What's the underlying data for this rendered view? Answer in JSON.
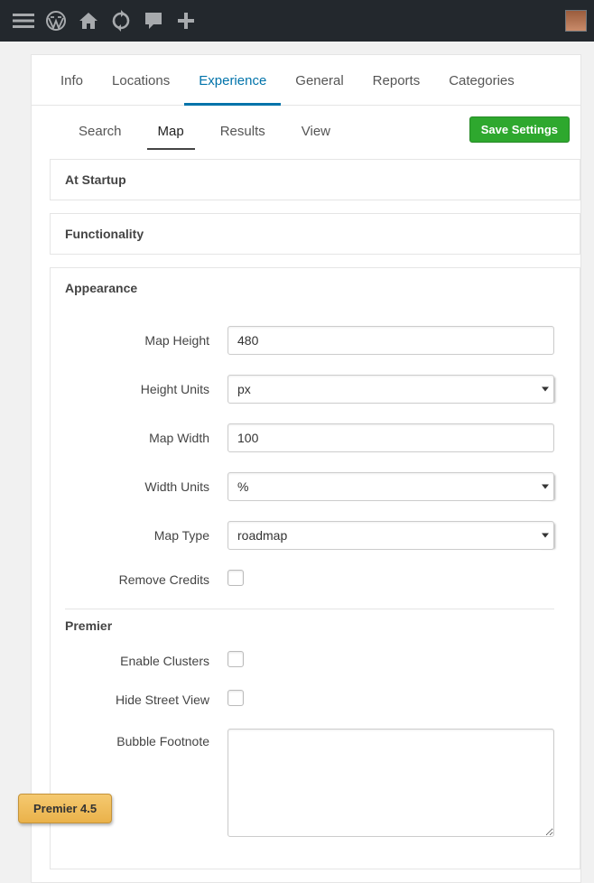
{
  "adminbar": {
    "icons": [
      "menu",
      "wordpress",
      "home",
      "refresh",
      "comment",
      "plus"
    ]
  },
  "primaryTabs": [
    {
      "label": "Info",
      "active": false
    },
    {
      "label": "Locations",
      "active": false
    },
    {
      "label": "Experience",
      "active": true
    },
    {
      "label": "General",
      "active": false
    },
    {
      "label": "Reports",
      "active": false
    },
    {
      "label": "Categories",
      "active": false
    }
  ],
  "secondaryTabs": [
    {
      "label": "Search",
      "active": false
    },
    {
      "label": "Map",
      "active": true
    },
    {
      "label": "Results",
      "active": false
    },
    {
      "label": "View",
      "active": false
    }
  ],
  "saveLabel": "Save Settings",
  "sections": {
    "atStartup": "At Startup",
    "functionality": "Functionality",
    "appearance": "Appearance",
    "premier": "Premier"
  },
  "fields": {
    "mapHeight": {
      "label": "Map Height",
      "value": "480"
    },
    "heightUnits": {
      "label": "Height Units",
      "value": "px"
    },
    "mapWidth": {
      "label": "Map Width",
      "value": "100"
    },
    "widthUnits": {
      "label": "Width Units",
      "value": "%"
    },
    "mapType": {
      "label": "Map Type",
      "value": "roadmap"
    },
    "removeCredits": {
      "label": "Remove Credits",
      "checked": false
    },
    "enableClusters": {
      "label": "Enable Clusters",
      "checked": false
    },
    "hideStreetView": {
      "label": "Hide Street View",
      "checked": false
    },
    "bubbleFootnote": {
      "label": "Bubble Footnote",
      "value": ""
    }
  },
  "premierBadge": "Premier 4.5"
}
